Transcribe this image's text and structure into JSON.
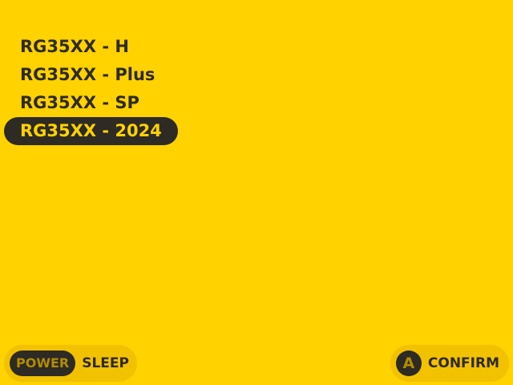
{
  "menu": {
    "items": [
      {
        "label": "RG35XX - H"
      },
      {
        "label": "RG35XX - Plus"
      },
      {
        "label": "RG35XX - SP"
      },
      {
        "label": "RG35XX - 2024"
      }
    ],
    "selected_index": 3
  },
  "hints": {
    "power": {
      "key": "POWER",
      "label": "SLEEP"
    },
    "confirm": {
      "key": "A",
      "label": "CONFIRM"
    }
  },
  "colors": {
    "background": "#FFD200",
    "text": "#2E2A24",
    "hint_background": "#F2C100",
    "key_text": "#B08C00"
  }
}
